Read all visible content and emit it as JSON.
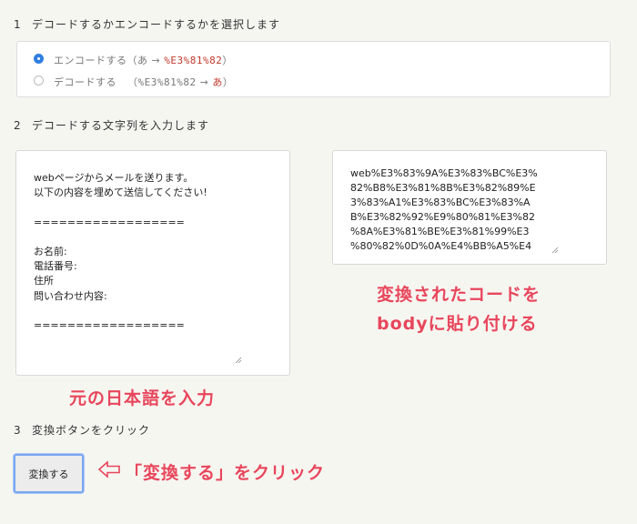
{
  "steps": {
    "step1": {
      "num": "1",
      "label": "デコードするかエンコードするかを選択します"
    },
    "step2": {
      "num": "2",
      "label": "デコードする文字列を入力します"
    },
    "step3": {
      "num": "3",
      "label": "変換ボタンをクリック"
    }
  },
  "radio": {
    "encode": {
      "label": "エンコードする",
      "paren_open": "（あ → ",
      "code": "%E3%81%82",
      "paren_close": "）",
      "checked": true
    },
    "decode": {
      "label": "デコードする",
      "paren_open": "（",
      "code": "%E3%81%82",
      "arrow": " → ",
      "char": "あ",
      "paren_close": "）",
      "checked": false
    }
  },
  "input": {
    "lines": "webページからメールを送ります。\n以下の内容を埋めて送信してください!\n\n==================\n\nお名前:\n電話番号:\n住所\n問い合わせ内容:\n\n=================="
  },
  "output": {
    "lines": "web%E3%83%9A%E3%83%BC%E3%\n82%B8%E3%81%8B%E3%82%89%E\n3%83%A1%E3%83%BC%E3%83%A\nB%E3%82%92%E9%80%81%E3%82\n%8A%E3%81%BE%E3%81%99%E3\n%80%82%0D%0A%E4%BB%A5%E4"
  },
  "annotations": {
    "output_line1": "変換されたコードを",
    "output_line2": "bodyに貼り付ける",
    "input_note": "元の日本語を入力",
    "button_note": "「変換する」をクリック"
  },
  "button": {
    "label": "変換する"
  },
  "colors": {
    "background": "#f6f6f1",
    "annotation": "#e8465c",
    "radio_accent": "#2f7de1",
    "code_red": "#c0392b"
  }
}
